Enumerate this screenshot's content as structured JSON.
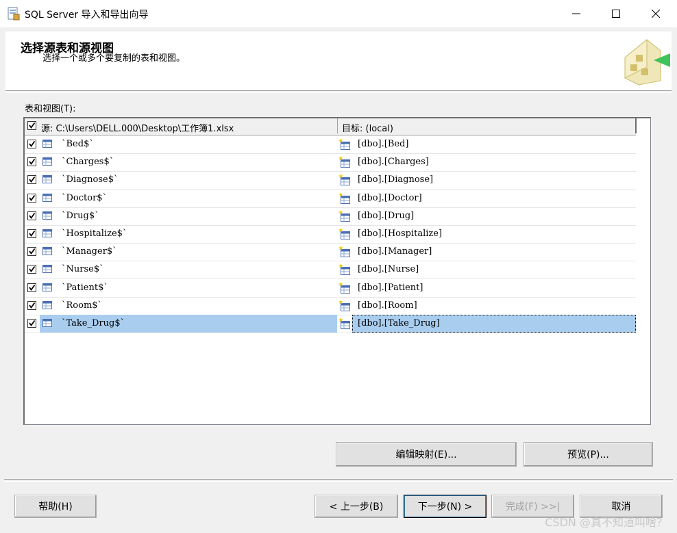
{
  "window": {
    "title": "SQL Server 导入和导出向导",
    "minimize_glyph": "—",
    "maximize_glyph": "☐",
    "close_glyph": "✕"
  },
  "header": {
    "title": "选择源表和源视图",
    "subtitle": "选择一个或多个要复制的表和视图。",
    "graphic_icon": "wizard-graphic-icon"
  },
  "list": {
    "label": "表和视图(T):",
    "source_header": "源: C:\\Users\\DELL.000\\Desktop\\工作簿1.xlsx",
    "target_header": "目标: (local)",
    "rows": [
      {
        "source": "`Bed$`",
        "target": "[dbo].[Bed]",
        "checked": true
      },
      {
        "source": "`Charges$`",
        "target": "[dbo].[Charges]",
        "checked": true
      },
      {
        "source": "`Diagnose$`",
        "target": "[dbo].[Diagnose]",
        "checked": true
      },
      {
        "source": "`Doctor$`",
        "target": "[dbo].[Doctor]",
        "checked": true
      },
      {
        "source": "`Drug$`",
        "target": "[dbo].[Drug]",
        "checked": true
      },
      {
        "source": "`Hospitalize$`",
        "target": "[dbo].[Hospitalize]",
        "checked": true
      },
      {
        "source": "`Manager$`",
        "target": "[dbo].[Manager]",
        "checked": true
      },
      {
        "source": "`Nurse$`",
        "target": "[dbo].[Nurse]",
        "checked": true
      },
      {
        "source": "`Patient$`",
        "target": "[dbo].[Patient]",
        "checked": true
      },
      {
        "source": "`Room$`",
        "target": "[dbo].[Room]",
        "checked": true
      },
      {
        "source": "`Take_Drug$`",
        "target": "[dbo].[Take_Drug]",
        "checked": true,
        "selected": true
      }
    ]
  },
  "buttons": {
    "edit_mappings": "编辑映射(E)...",
    "preview": "预览(P)...",
    "help": "帮助(H)",
    "back": "< 上一步(B)",
    "next": "下一步(N) >",
    "finish": "完成(F) >>|",
    "cancel": "取消"
  },
  "watermark": "CSDN @真不知道叫啥？",
  "colors": {
    "selection": "#a8cdee",
    "window_bg": "#f0f0f0"
  }
}
